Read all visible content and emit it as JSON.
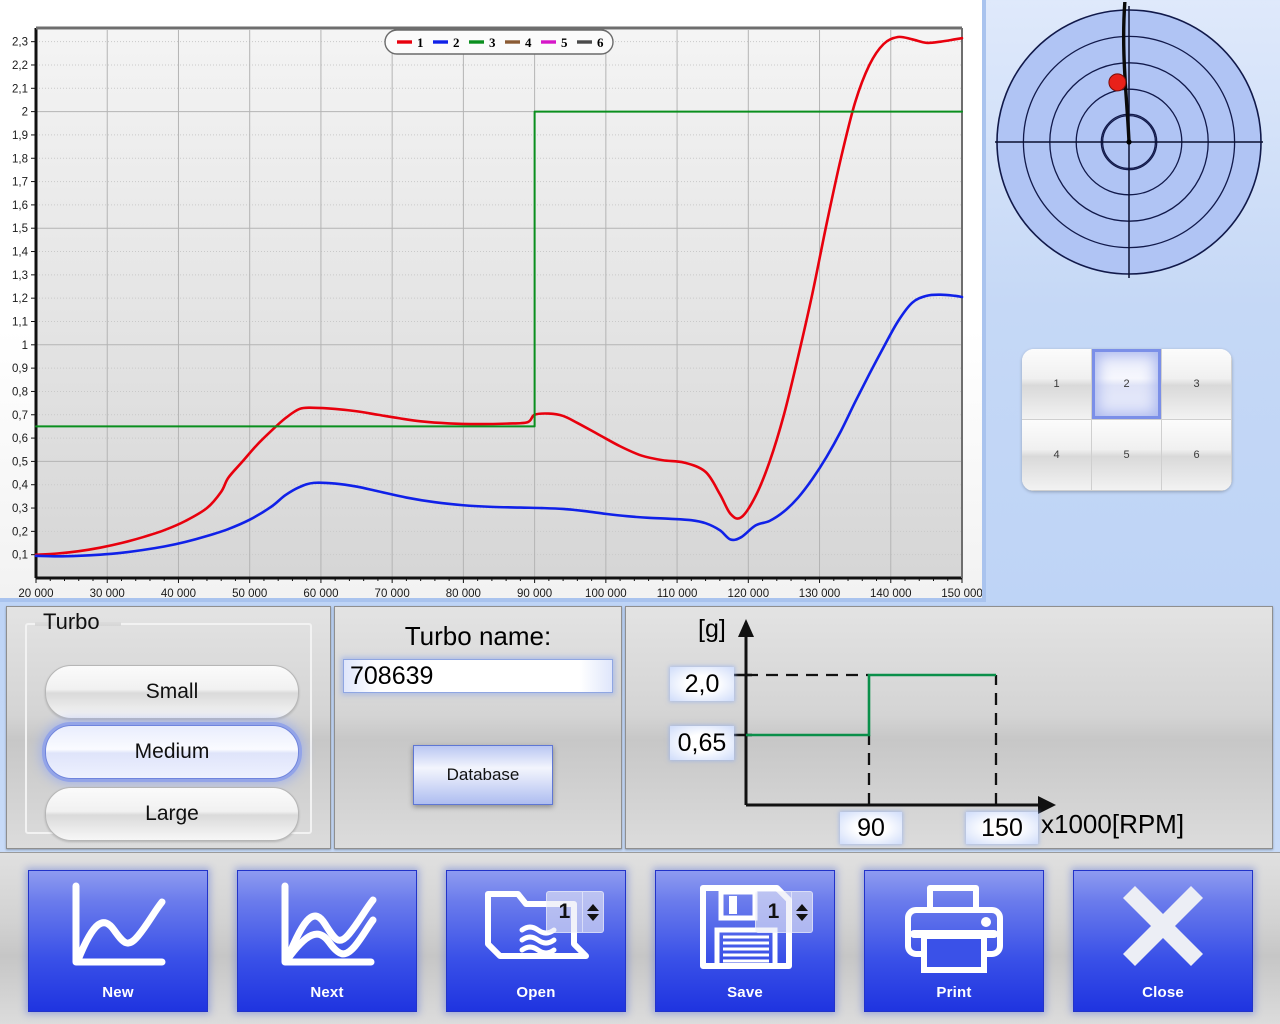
{
  "chart_data": {
    "type": "line",
    "title": "",
    "xlabel": "",
    "ylabel": "",
    "xlim": [
      20000,
      150000
    ],
    "ylim": [
      0,
      2.35
    ],
    "grid": true,
    "legend_position": "top-center",
    "x_ticks": [
      "20 000",
      "30 000",
      "40 000",
      "50 000",
      "60 000",
      "70 000",
      "80 000",
      "90 000",
      "100 000",
      "110 000",
      "120 000",
      "130 000",
      "140 000",
      "150 000"
    ],
    "y_ticks": [
      "0,1",
      "0,2",
      "0,3",
      "0,4",
      "0,5",
      "0,6",
      "0,7",
      "0,8",
      "0,9",
      "1",
      "1,1",
      "1,2",
      "1,3",
      "1,4",
      "1,5",
      "1,6",
      "1,7",
      "1,8",
      "1,9",
      "2",
      "2,1",
      "2,2",
      "2,3"
    ],
    "legend": [
      {
        "label": "1",
        "color": "#e8000d"
      },
      {
        "label": "2",
        "color": "#1021e8"
      },
      {
        "label": "3",
        "color": "#0a8f1e"
      },
      {
        "label": "4",
        "color": "#8a5a33"
      },
      {
        "label": "5",
        "color": "#d616c8"
      },
      {
        "label": "6",
        "color": "#4a4a4a"
      }
    ],
    "series": [
      {
        "name": "1",
        "color": "#e8000d",
        "x": [
          20000,
          23000,
          26000,
          29000,
          32000,
          35000,
          38000,
          41000,
          44000,
          46000,
          47000,
          49000,
          51000,
          53000,
          55000,
          57000,
          59000,
          62000,
          65000,
          68000,
          71000,
          74000,
          78000,
          82000,
          86000,
          89000,
          90000,
          92000,
          94000,
          96000,
          99000,
          102000,
          105000,
          108000,
          111000,
          114000,
          116000,
          117500,
          119000,
          121000,
          123000,
          125000,
          127000,
          129000,
          131000,
          133000,
          135000,
          137000,
          139000,
          141000,
          143000,
          145000,
          147000,
          149000,
          150000
        ],
        "y": [
          0.1,
          0.105,
          0.115,
          0.13,
          0.15,
          0.175,
          0.205,
          0.245,
          0.3,
          0.37,
          0.43,
          0.5,
          0.57,
          0.63,
          0.685,
          0.725,
          0.73,
          0.725,
          0.715,
          0.7,
          0.685,
          0.672,
          0.663,
          0.66,
          0.662,
          0.668,
          0.7,
          0.705,
          0.695,
          0.665,
          0.615,
          0.565,
          0.525,
          0.505,
          0.495,
          0.455,
          0.36,
          0.275,
          0.26,
          0.35,
          0.5,
          0.7,
          0.95,
          1.22,
          1.52,
          1.8,
          2.04,
          2.2,
          2.29,
          2.32,
          2.31,
          2.295,
          2.3,
          2.31,
          2.315
        ]
      },
      {
        "name": "2",
        "color": "#1021e8",
        "x": [
          20000,
          23000,
          26000,
          29000,
          32000,
          35000,
          38000,
          41000,
          44000,
          47000,
          50000,
          53000,
          55000,
          57000,
          59000,
          62000,
          65000,
          68000,
          72000,
          76000,
          80000,
          84000,
          88000,
          91000,
          94000,
          97000,
          100000,
          103000,
          106000,
          109000,
          112000,
          114000,
          116000,
          117500,
          119000,
          121000,
          123000,
          125000,
          127000,
          129000,
          131000,
          133000,
          135000,
          137000,
          139000,
          141000,
          143000,
          145000,
          147000,
          149000,
          150000
        ],
        "y": [
          0.095,
          0.093,
          0.095,
          0.1,
          0.108,
          0.12,
          0.135,
          0.155,
          0.18,
          0.21,
          0.25,
          0.305,
          0.355,
          0.39,
          0.408,
          0.405,
          0.392,
          0.372,
          0.345,
          0.325,
          0.312,
          0.305,
          0.302,
          0.3,
          0.296,
          0.287,
          0.275,
          0.265,
          0.258,
          0.254,
          0.248,
          0.235,
          0.205,
          0.165,
          0.175,
          0.225,
          0.245,
          0.285,
          0.345,
          0.425,
          0.52,
          0.63,
          0.755,
          0.875,
          0.99,
          1.1,
          1.18,
          1.21,
          1.215,
          1.21,
          1.205
        ]
      },
      {
        "name": "3",
        "color": "#0a8f1e",
        "x": [
          20000,
          90000,
          90000,
          150000
        ],
        "y": [
          0.65,
          0.65,
          2.0,
          2.0
        ]
      }
    ]
  },
  "polar": {
    "rings": 5,
    "fill_color": "#b0c4f4",
    "stroke_color": "#11194a",
    "marker_color": "#e8211a",
    "marker": {
      "angle_deg": 101,
      "radius_frac": 0.46
    },
    "trace_top_angle_deg": 93
  },
  "cell_grid": {
    "cells": [
      "1",
      "2",
      "3",
      "4",
      "5",
      "6"
    ],
    "selected": "2"
  },
  "turbo": {
    "group_title": "Turbo",
    "options": [
      "Small",
      "Medium",
      "Large"
    ],
    "selected": "Medium"
  },
  "turbo_name": {
    "label": "Turbo name:",
    "value": "708639",
    "placeholder": "",
    "database_button": "Database"
  },
  "limit_graph": {
    "y_axis_label": "[g]",
    "x_axis_label": "x1000[RPM]",
    "y_high": "2,0",
    "y_low": "0,65",
    "x_mid": "90",
    "x_max": "150",
    "line_color": "#0a8f4a"
  },
  "toolbar": {
    "buttons": [
      {
        "label": "New",
        "icon": "single-curve-icon",
        "spinner": null
      },
      {
        "label": "Next",
        "icon": "double-curve-icon",
        "spinner": null
      },
      {
        "label": "Open",
        "icon": "folder-icon",
        "spinner": "1"
      },
      {
        "label": "Save",
        "icon": "floppy-disk-icon",
        "spinner": "1"
      },
      {
        "label": "Print",
        "icon": "printer-icon",
        "spinner": null
      },
      {
        "label": "Close",
        "icon": "close-x-icon",
        "spinner": null
      }
    ]
  }
}
